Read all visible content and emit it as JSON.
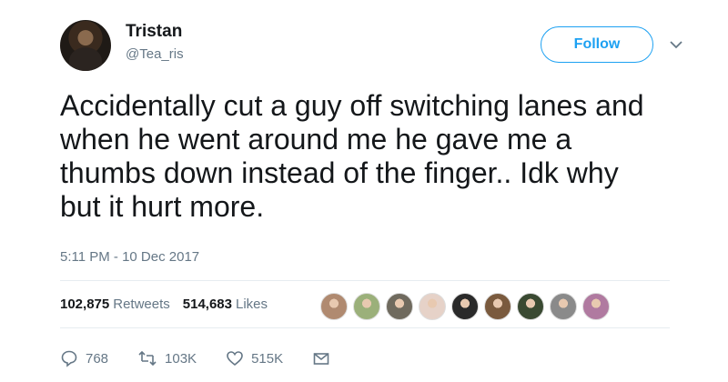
{
  "user": {
    "name": "Tristan",
    "handle": "@Tea_ris"
  },
  "follow_label": "Follow",
  "tweet": {
    "text": "Accidentally cut a guy off switching lanes and\nwhen he went around me he gave me a\nthumbs down instead of the finger.. Idk why\nbut it hurt more.",
    "timestamp": "5:11 PM - 10 Dec 2017"
  },
  "stats": {
    "retweets_count": "102,875",
    "retweets_label": "Retweets",
    "likes_count": "514,683",
    "likes_label": "Likes"
  },
  "liker_avatars": [
    "#b08a70",
    "#9bb07a",
    "#6f6a5e",
    "#e6d2c8",
    "#2a2a2a",
    "#7a5a3e",
    "#3a4a32",
    "#8a8a8a",
    "#b07aa0"
  ],
  "actions": {
    "replies": "768",
    "retweets": "103K",
    "likes": "515K"
  },
  "colors": {
    "accent": "#1da1f2",
    "secondary_text": "#657786",
    "primary_text": "#14171a"
  }
}
